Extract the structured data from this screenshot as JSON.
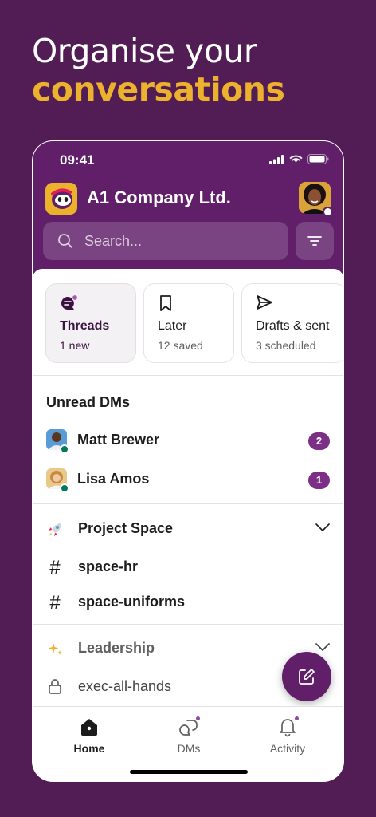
{
  "headline": {
    "line1": "Organise your",
    "line2": "conversations"
  },
  "status_bar": {
    "time": "09:41"
  },
  "workspace": {
    "name": "A1 Company Ltd."
  },
  "search": {
    "placeholder": "Search..."
  },
  "quick_cards": [
    {
      "title": "Threads",
      "subtitle": "1 new",
      "icon": "thread-icon"
    },
    {
      "title": "Later",
      "subtitle": "12 saved",
      "icon": "bookmark-icon"
    },
    {
      "title": "Drafts & sent",
      "subtitle": "3 scheduled",
      "icon": "send-icon"
    }
  ],
  "unread_dms": {
    "title": "Unread DMs",
    "items": [
      {
        "name": "Matt Brewer",
        "count": "2"
      },
      {
        "name": "Lisa Amos",
        "count": "1"
      }
    ]
  },
  "sections": [
    {
      "title": "Project Space",
      "icon": "rocket-icon",
      "channels": [
        "space-hr",
        "space-uniforms"
      ]
    },
    {
      "title": "Leadership",
      "icon": "sparkles-icon",
      "channels": [
        "exec-all-hands"
      ]
    }
  ],
  "tabs": [
    {
      "label": "Home",
      "icon": "home-icon"
    },
    {
      "label": "DMs",
      "icon": "dms-icon"
    },
    {
      "label": "Activity",
      "icon": "bell-icon"
    }
  ],
  "colors": {
    "background": "#521d54",
    "brand_aubergine": "#611f69",
    "accent_yellow": "#ecb22e",
    "badge": "#7c3085",
    "online": "#007a5a"
  }
}
